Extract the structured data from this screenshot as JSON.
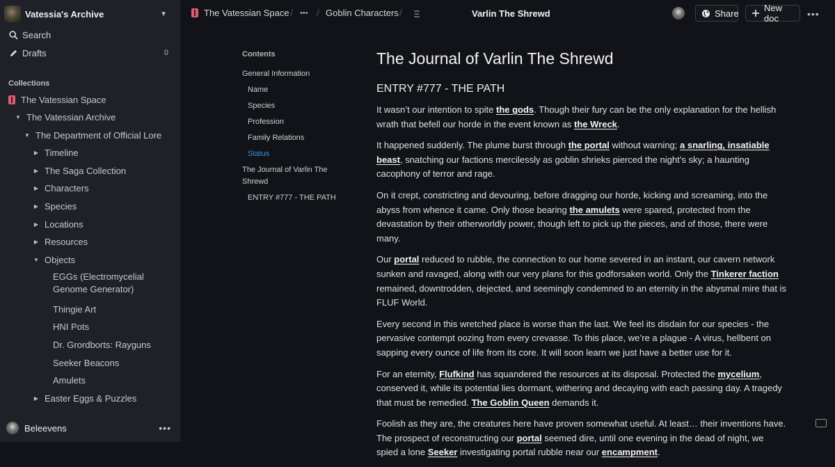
{
  "sidebar": {
    "workspace_name": "Vatessia's Archive",
    "search_label": "Search",
    "drafts_label": "Drafts",
    "drafts_count": "0",
    "collections_label": "Collections",
    "tree": [
      "The Vatessian Space",
      "The Vatessian Archive",
      "The Department of Official Lore",
      "Timeline",
      "The Saga Collection",
      "Characters",
      "Species",
      "Locations",
      "Resources",
      "Objects",
      "EGGs (Electromycelial Genome Generator)",
      "Thingie Art",
      "HNI Pots",
      "Dr. Grordborts: Rayguns",
      "Seeker Beacons",
      "Amulets",
      "Easter Eggs & Puzzles"
    ],
    "user_name": "Beleevens"
  },
  "header": {
    "crumb_space": "The Vatessian Space",
    "crumb_more": "•••",
    "crumb_goblin": "Goblin Characters",
    "doc_title": "Varlin The Shrewd",
    "share_label": "Share",
    "new_doc_label": "New doc",
    "more": "•••"
  },
  "toc": {
    "heading": "Contents",
    "items": [
      "General Information",
      "Name",
      "Species",
      "Profession",
      "Family Relations",
      "Status",
      "The Journal of Varlin The Shrewd",
      "ENTRY #777 - THE PATH"
    ]
  },
  "doc": {
    "title": "The Journal of Varlin The Shrewd",
    "entry": "ENTRY #777 - THE PATH",
    "p1": [
      "It wasn’t our intention to spite ",
      "the gods",
      ". Though their fury can be the only explanation for the hellish wrath that befell our horde in the event known as ",
      "the Wreck",
      "."
    ],
    "p2": [
      "It happened suddenly. The plume burst through ",
      "the portal",
      " without warning; ",
      "a snarling, insatiable beast",
      ", snatching our factions mercilessly as goblin shrieks pierced the night’s sky; a haunting cacophony of terror and rage."
    ],
    "p3": [
      "On it crept, constricting and devouring, before dragging our horde, kicking and screaming, into the abyss from whence it came. Only those bearing ",
      "the amulets",
      " were spared, protected from the devastation by their otherworldly power, though left to pick up the pieces, and of those, there were many."
    ],
    "p4": [
      "Our ",
      "portal",
      " reduced to rubble, the connection to our home severed in an instant, our cavern network sunken and ravaged, along with our very plans for this godforsaken world. Only the ",
      "Tinkerer faction",
      " remained, downtrodden, dejected, and seemingly condemned to an eternity in the abysmal mire that is FLUF World."
    ],
    "p5": [
      "Every second in this wretched place is worse than the last. We feel its disdain for our species - the pervasive contempt oozing from every crevasse. To this place, we’re a plague - A virus, hellbent on sapping every ounce of life from its core. It will soon learn we just have a better use for it."
    ],
    "p6": [
      "For an eternity, ",
      "Flufkind",
      " has squandered the resources at its disposal. Protected the ",
      "mycelium",
      ", conserved it, while its potential lies dormant, withering and decaying with each passing day. A tragedy that must be remedied. ",
      "The Goblin Queen",
      " demands it."
    ],
    "p7": [
      "Foolish as they are, the creatures here have proven somewhat useful. At least… their inventions have. The prospect of reconstructing our ",
      "portal",
      " seemed dire, until one evening in the dead of night, we spied a lone ",
      "Seeker",
      " investigating portal rubble near our ",
      "encampment",
      "."
    ]
  },
  "colors": {
    "background": "#111319",
    "sidebar": "#1f2128",
    "accent": "#3a8fe3",
    "collection_icon": "#e25b6e"
  },
  "icons": [
    "search-icon",
    "pencil-icon",
    "book-icon",
    "chevron-down-icon",
    "globe-icon",
    "plus-icon",
    "keyboard-icon",
    "list-icon"
  ]
}
